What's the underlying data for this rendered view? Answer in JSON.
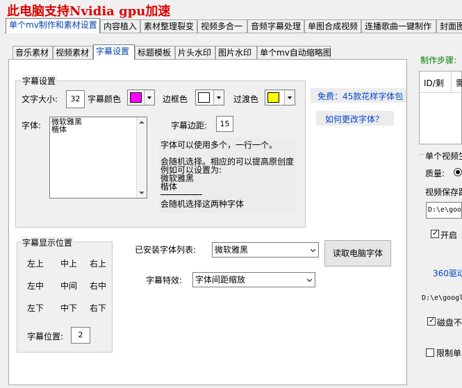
{
  "app_title": "此电脑支持Nvidia gpu加速",
  "top_tabs": [
    "单个mv制作和素材设置",
    "内容植入",
    "素材整理裂变",
    "视频多合一",
    "音频字幕处理",
    "单图合成视频",
    "连播歌曲一键制作",
    "封面图"
  ],
  "sub_tabs": [
    "音乐素材",
    "视频素材",
    "字幕设置",
    "标题模板",
    "片头水印",
    "图片水印",
    "单个mv自动缩略图"
  ],
  "subtitle_settings": {
    "group_label": "字幕设置",
    "font_size_label": "文字大小:",
    "font_size_value": "32",
    "text_color_label": "字幕颜色",
    "text_color": "#ff00ff",
    "border_color_label": "边框色",
    "border_color": "#ffffff",
    "transition_color_label": "过渡色",
    "transition_color": "#ffff00",
    "font_label": "字体:",
    "fonts": [
      "微软雅黑",
      "楷体"
    ],
    "margin_label": "字幕边距:",
    "margin_value": "15",
    "hint_lines": [
      "字体可以使用多个，一行一个。",
      "会随机选择。相应的可以提高原创度",
      "例如可以设置为:",
      "微软雅黑",
      "楷体",
      "会随机选择这两种字体"
    ]
  },
  "links": {
    "free_fonts": "免费：45款花样字体包",
    "change_font": "如何更改字体？"
  },
  "position": {
    "group_label": "字幕显示位置",
    "grid": [
      [
        "左上",
        "中上",
        "右上"
      ],
      [
        "左中",
        "中间",
        "右中"
      ],
      [
        "左下",
        "中下",
        "右下"
      ]
    ],
    "pos_label": "字幕位置:",
    "pos_value": "2"
  },
  "installed_fonts": {
    "label": "已安装字体列表:",
    "selected": "微软雅黑",
    "read_button": "读取电脑字体"
  },
  "effect": {
    "label": "字幕特效:",
    "selected": "字体间距缩放"
  },
  "right_panel": {
    "steps_label": "制作步骤:",
    "table_header": [
      "ID/剩",
      "需"
    ],
    "single_video_label": "单个视频生",
    "quality_label": "质量:",
    "save_path_label": "视频保存路",
    "path_value_1": "D:\\e\\goog",
    "enable_label": "开启",
    "driver_link": "360驱动",
    "path_value_2": "D:\\e\\googl",
    "disk_label": "磁盘不",
    "limit_label": "限制单"
  }
}
